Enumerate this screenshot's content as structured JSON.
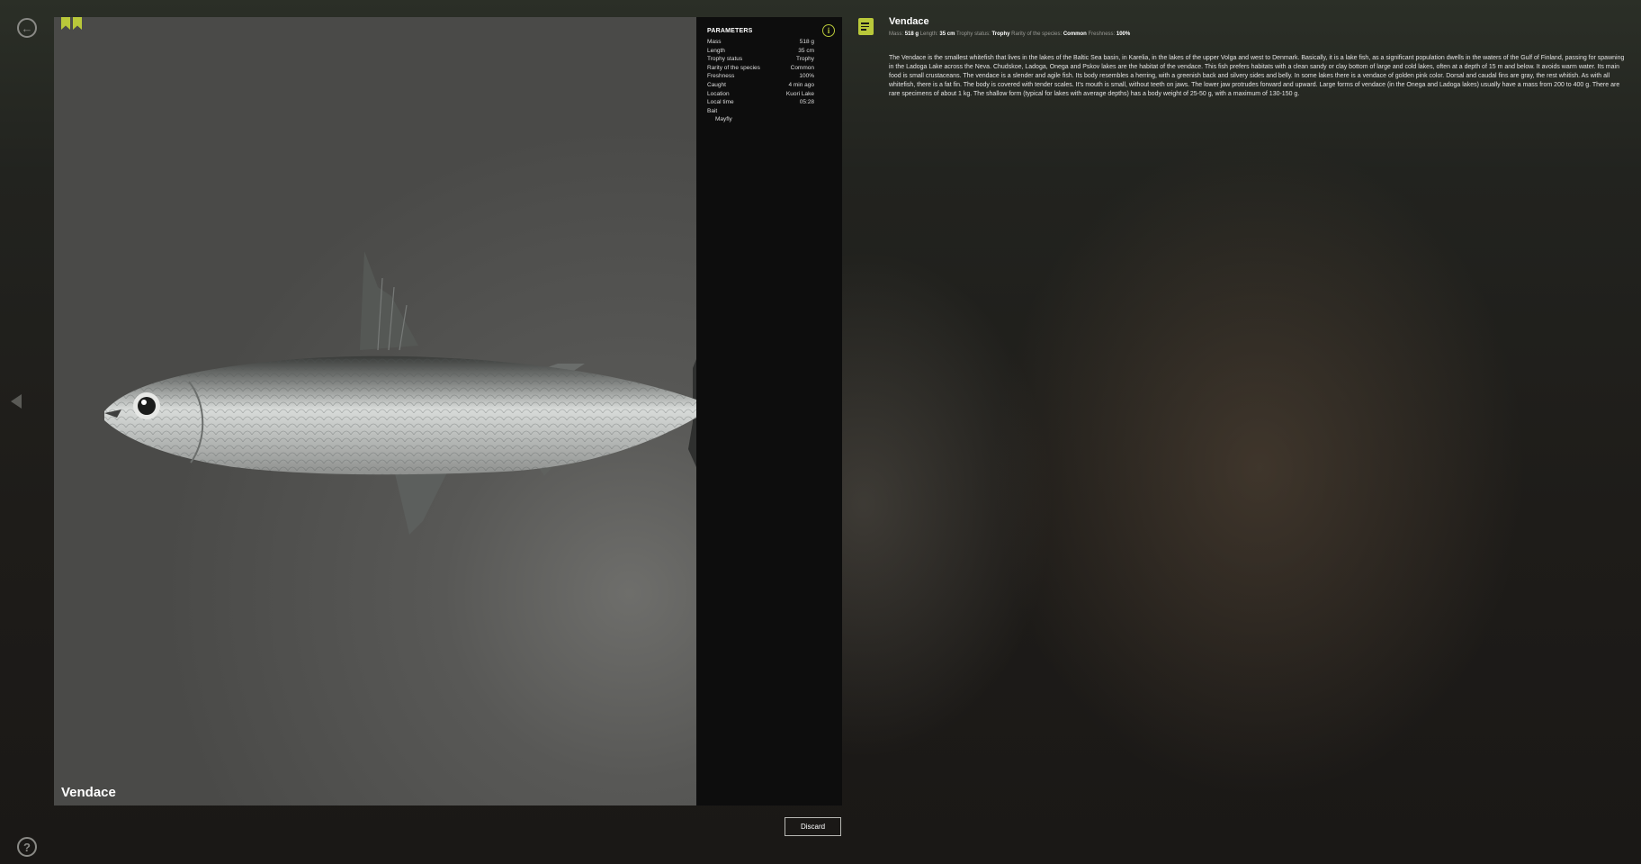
{
  "navigation": {
    "back_icon": "back-arrow-icon",
    "help_icon": "question-mark-icon",
    "prev_icon": "chevron-left-icon"
  },
  "photo": {
    "fish_name": "Vendace",
    "bookmark_icons": [
      "bookmark-check-icon",
      "bookmark-icon"
    ],
    "accent_color": "#b9c83a"
  },
  "parameters": {
    "title": "PARAMETERS",
    "info_icon": "info-icon",
    "rows": [
      {
        "label": "Mass",
        "value": "518 g"
      },
      {
        "label": "Length",
        "value": "35 cm"
      },
      {
        "label": "Trophy status",
        "value": "Trophy"
      },
      {
        "label": "Rarity of the species",
        "value": "Common"
      },
      {
        "label": "Freshness",
        "value": "100%"
      },
      {
        "label": "Caught",
        "value": "4 min ago"
      },
      {
        "label": "Location",
        "value": "Kuori Lake"
      },
      {
        "label": "Local time",
        "value": "05:28"
      }
    ],
    "bait_label": "Bait",
    "bait_value": "Mayfly"
  },
  "description": {
    "note_icon": "note-icon",
    "title": "Vendace",
    "stats": [
      {
        "label": "Mass:",
        "value": "518 g"
      },
      {
        "label": "Length:",
        "value": "35 cm"
      },
      {
        "label": "Trophy status:",
        "value": "Trophy"
      },
      {
        "label": "Rarity of the species:",
        "value": "Common"
      },
      {
        "label": "Freshness:",
        "value": "100%"
      }
    ],
    "text": "The Vendace is the smallest whitefish that lives in the lakes of the Baltic Sea basin, in Karelia, in the lakes of the upper Volga and west to Denmark. Basically, it is a lake fish, as a significant population dwells in the waters of the Gulf of Finland, passing for spawning in the Ladoga Lake across the Neva. Chudskoe, Ladoga, Onega and Pskov lakes are the habitat of the vendace. This fish prefers habitats with a clean sandy or clay bottom of large and cold lakes, often at a depth of 15 m and below. It avoids warm water. Its main food is small crustaceans. The vendace is a slender and agile fish. Its body resembles a herring, with a greenish back and silvery sides and belly. In some lakes there is a vendace of golden pink color. Dorsal and caudal fins are gray, the rest whitish. As with all whitefish, there is a fat fin. The body is covered with tender scales. It's mouth is small, without teeth on jaws. The lower jaw protrudes forward and upward. Large forms of vendace (in the Onega and Ladoga lakes) usually have a mass from 200 to 400 g. There are rare specimens of about 1 kg. The shallow form (typical for lakes with average depths) has a body weight of 25-50 g, with a maximum of 130-150 g."
  },
  "actions": {
    "discard_label": "Discard"
  }
}
